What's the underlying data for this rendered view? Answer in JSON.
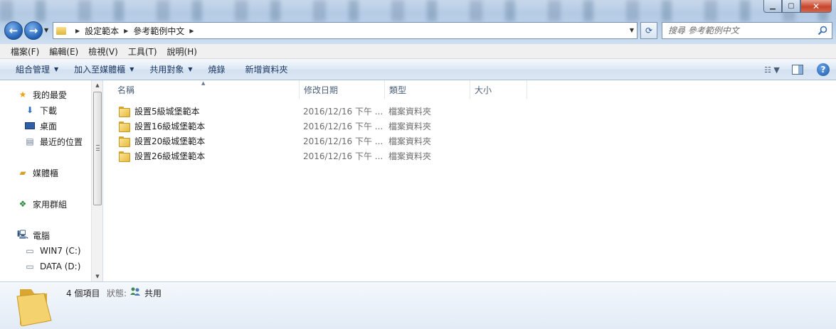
{
  "window": {
    "minimize_icon": "minimize-icon",
    "maximize_icon": "maximize-icon",
    "close_icon": "close-icon"
  },
  "address": {
    "breadcrumbs": [
      "設定範本",
      "參考範例中文"
    ]
  },
  "search": {
    "placeholder": "搜尋 參考範例中文"
  },
  "menu": {
    "items": [
      "檔案(F)",
      "編輯(E)",
      "檢視(V)",
      "工具(T)",
      "說明(H)"
    ]
  },
  "commands": {
    "organize": "組合管理",
    "add_to_library": "加入至媒體櫃",
    "share_with": "共用對象",
    "burn": "燒錄",
    "new_folder": "新增資料夾"
  },
  "nav_pane": {
    "favorites": "我的最愛",
    "favorites_items": [
      "下載",
      "桌面",
      "最近的位置"
    ],
    "libraries": "媒體櫃",
    "homegroup": "家用群組",
    "computer": "電腦",
    "computer_items": [
      "WIN7 (C:)",
      "DATA (D:)"
    ]
  },
  "columns": {
    "name": "名稱",
    "modified": "修改日期",
    "type": "類型",
    "size": "大小"
  },
  "files": [
    {
      "name": "設置5級城堡範本",
      "modified": "2016/12/16 下午 ...",
      "type": "檔案資料夾"
    },
    {
      "name": "設置16級城堡範本",
      "modified": "2016/12/16 下午 ...",
      "type": "檔案資料夾"
    },
    {
      "name": "設置20級城堡範本",
      "modified": "2016/12/16 下午 ...",
      "type": "檔案資料夾"
    },
    {
      "name": "設置26級城堡範本",
      "modified": "2016/12/16 下午 ...",
      "type": "檔案資料夾"
    }
  ],
  "details": {
    "count": "4 個項目",
    "state_label": "狀態:",
    "state_value": "共用"
  }
}
